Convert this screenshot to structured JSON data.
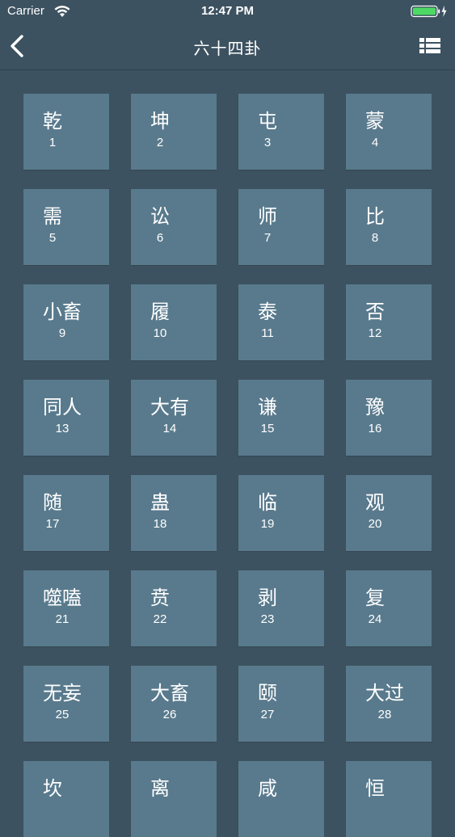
{
  "status_bar": {
    "carrier": "Carrier",
    "time": "12:47 PM",
    "icons": [
      "wifi-icon",
      "battery-icon",
      "charging-bolt-icon"
    ],
    "battery_color": "#4cd964"
  },
  "nav": {
    "title": "六十四卦",
    "back_icon": "chevron-left-icon",
    "right_icon": "list-icon"
  },
  "colors": {
    "background": "#3d5260",
    "tile": "#597a8d",
    "text": "#ffffff"
  },
  "hexagrams": [
    {
      "name": "乾",
      "number": "1"
    },
    {
      "name": "坤",
      "number": "2"
    },
    {
      "name": "屯",
      "number": "3"
    },
    {
      "name": "蒙",
      "number": "4"
    },
    {
      "name": "需",
      "number": "5"
    },
    {
      "name": "讼",
      "number": "6"
    },
    {
      "name": "师",
      "number": "7"
    },
    {
      "name": "比",
      "number": "8"
    },
    {
      "name": "小畜",
      "number": "9"
    },
    {
      "name": "履",
      "number": "10"
    },
    {
      "name": "泰",
      "number": "11"
    },
    {
      "name": "否",
      "number": "12"
    },
    {
      "name": "同人",
      "number": "13"
    },
    {
      "name": "大有",
      "number": "14"
    },
    {
      "name": "谦",
      "number": "15"
    },
    {
      "name": "豫",
      "number": "16"
    },
    {
      "name": "随",
      "number": "17"
    },
    {
      "name": "蛊",
      "number": "18"
    },
    {
      "name": "临",
      "number": "19"
    },
    {
      "name": "观",
      "number": "20"
    },
    {
      "name": "噬嗑",
      "number": "21"
    },
    {
      "name": "贲",
      "number": "22"
    },
    {
      "name": "剥",
      "number": "23"
    },
    {
      "name": "复",
      "number": "24"
    },
    {
      "name": "无妄",
      "number": "25"
    },
    {
      "name": "大畜",
      "number": "26"
    },
    {
      "name": "颐",
      "number": "27"
    },
    {
      "name": "大过",
      "number": "28"
    },
    {
      "name": "坎",
      "number": ""
    },
    {
      "name": "离",
      "number": ""
    },
    {
      "name": "咸",
      "number": ""
    },
    {
      "name": "恒",
      "number": ""
    }
  ]
}
